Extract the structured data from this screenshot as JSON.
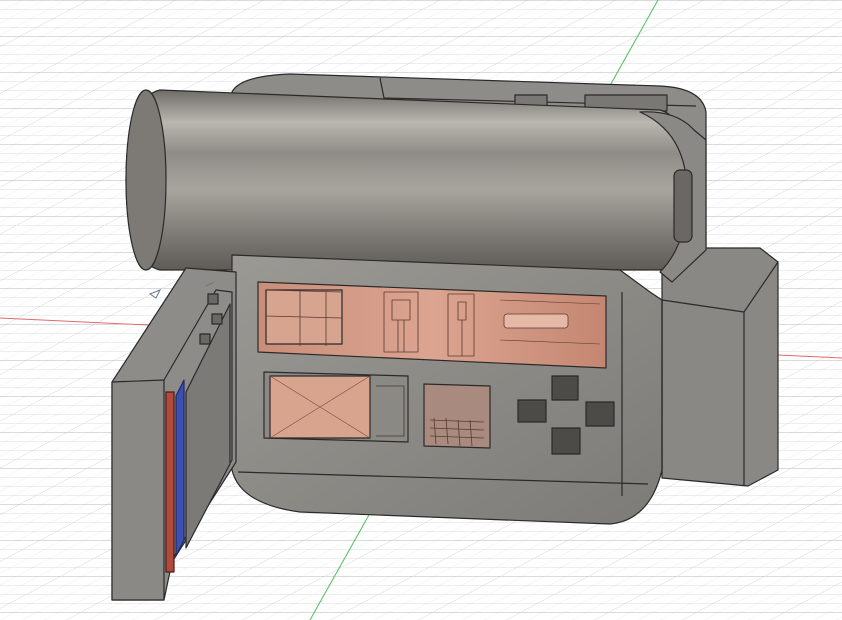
{
  "viewport": {
    "background": "#ffffff",
    "grid_color": "#c9ccd1",
    "x_axis_color": "#e06a6a",
    "y_axis_color": "#4fbf5a"
  },
  "model": {
    "body_color": "#8e8c88",
    "body_shadow": "#6f6d69",
    "body_light": "#a9a7a2",
    "edge_color": "#2a2a2a",
    "cavity_fill": "#d59a84",
    "battery_cover_color": "#b7a79b",
    "screen_blue": "#3d4fb2",
    "screen_red": "#b24a3c"
  }
}
